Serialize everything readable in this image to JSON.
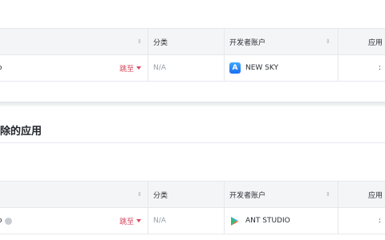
{
  "tables": [
    {
      "headers": {
        "col2": "分类",
        "col3": "开发者账户",
        "col4": "应用"
      },
      "row": {
        "col1_text": "o",
        "jump_label": "跳至",
        "category": "N/A",
        "developer": "NEW SKY",
        "store_icon": "app-store-icon"
      }
    },
    {
      "headers": {
        "col2": "分类",
        "col3": "开发者账户",
        "col4": "应用"
      },
      "row": {
        "col1_text": "o",
        "jump_label": "跳至",
        "category": "N/A",
        "developer": "ANT STUDIO",
        "store_icon": "google-play-icon"
      }
    }
  ],
  "section2": {
    "title": "除的应用"
  },
  "colors": {
    "accent": "#d5465b",
    "header_bg": "#f4f5f7",
    "border": "#e6e8ec"
  }
}
